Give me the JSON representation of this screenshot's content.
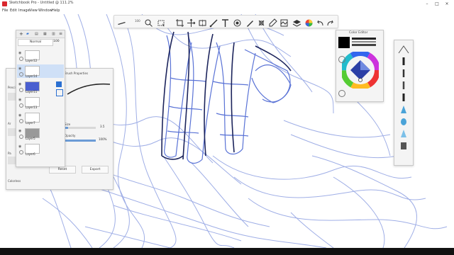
{
  "window": {
    "title": "Sketchbook Pro - Untitled @ 111.2%"
  },
  "menu": [
    "File",
    "Edit",
    "Image",
    "View",
    "Window",
    "Help"
  ],
  "toolbar": {
    "zoom_label": "100",
    "tools": [
      "brush-stroke",
      "search",
      "select",
      "crop",
      "transform",
      "symmetry",
      "ruler",
      "text",
      "stamp",
      "brush-props",
      "fill",
      "layers",
      "color-wheel",
      "undo",
      "redo"
    ]
  },
  "brush_properties": {
    "title": "Brush Properties",
    "labels": [
      "Pencil",
      "Ar",
      "Ar",
      "Pa"
    ],
    "size_label": "Size",
    "size_value": "3.5",
    "opacity_label": "Opacity",
    "opacity_value": "100%",
    "opacity_fraction": 1.0,
    "reset_label": "Reset",
    "export_label": "Export",
    "colorless_label": "Colorless"
  },
  "layers": {
    "blend_mode": "Normal",
    "opacity": "100",
    "items": [
      {
        "name": "Layer12",
        "selected": false
      },
      {
        "name": "Layer14",
        "selected": true
      },
      {
        "name": "Layer11",
        "selected": false
      },
      {
        "name": "Layer13",
        "selected": false
      },
      {
        "name": "Layer7",
        "selected": false
      },
      {
        "name": "Layer5",
        "selected": false
      },
      {
        "name": "Layer6",
        "selected": false
      }
    ]
  },
  "color_editor": {
    "title": "Color Editor",
    "current_color": "#000000"
  },
  "colors": {
    "stroke": "#5a73d6",
    "dark_stroke": "#1c245c",
    "accent": "#6b9bd6"
  }
}
